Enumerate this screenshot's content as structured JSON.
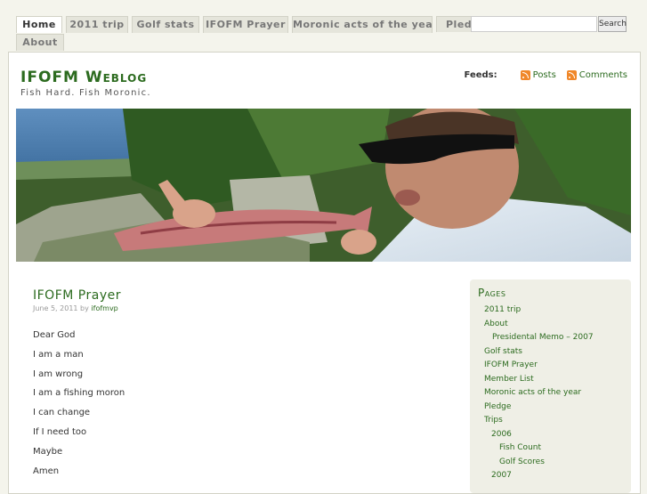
{
  "nav": {
    "tabs": [
      {
        "label": "Home"
      },
      {
        "label": "2011 trip"
      },
      {
        "label": "Golf stats"
      },
      {
        "label": "IFOFM Prayer"
      },
      {
        "label": "Moronic acts of the year"
      },
      {
        "label": "Pledge"
      },
      {
        "label": "About"
      }
    ],
    "search_button": "Search",
    "search_value": ""
  },
  "header": {
    "title": "IFOFM Weblog",
    "tagline": "Fish Hard. Fish Moronic.",
    "feeds_label": "Feeds:",
    "feed_posts": "Posts",
    "feed_comments": "Comments"
  },
  "post": {
    "title": "IFOFM Prayer",
    "date": "June 5, 2011 by",
    "author": "ifofmvp",
    "lines": [
      "Dear God",
      "I am a man",
      "I am wrong",
      "I am a fishing moron",
      "I can change",
      "If I need too",
      "Maybe",
      "Amen"
    ]
  },
  "sidebar": {
    "heading": "Pages",
    "items": [
      {
        "label": "2011 trip"
      },
      {
        "label": "About"
      },
      {
        "label": "Presidental Memo – 2007"
      },
      {
        "label": "Golf stats"
      },
      {
        "label": "IFOFM Prayer"
      },
      {
        "label": "Member List"
      },
      {
        "label": "Moronic acts of the year"
      },
      {
        "label": "Pledge"
      },
      {
        "label": "Trips"
      },
      {
        "label": "2006"
      },
      {
        "label": "Fish Count"
      },
      {
        "label": "Golf Scores"
      },
      {
        "label": "2007"
      }
    ]
  },
  "colors": {
    "accent": "#2c6b1f",
    "background": "#f4f4ec",
    "rss": "#f0882a"
  }
}
